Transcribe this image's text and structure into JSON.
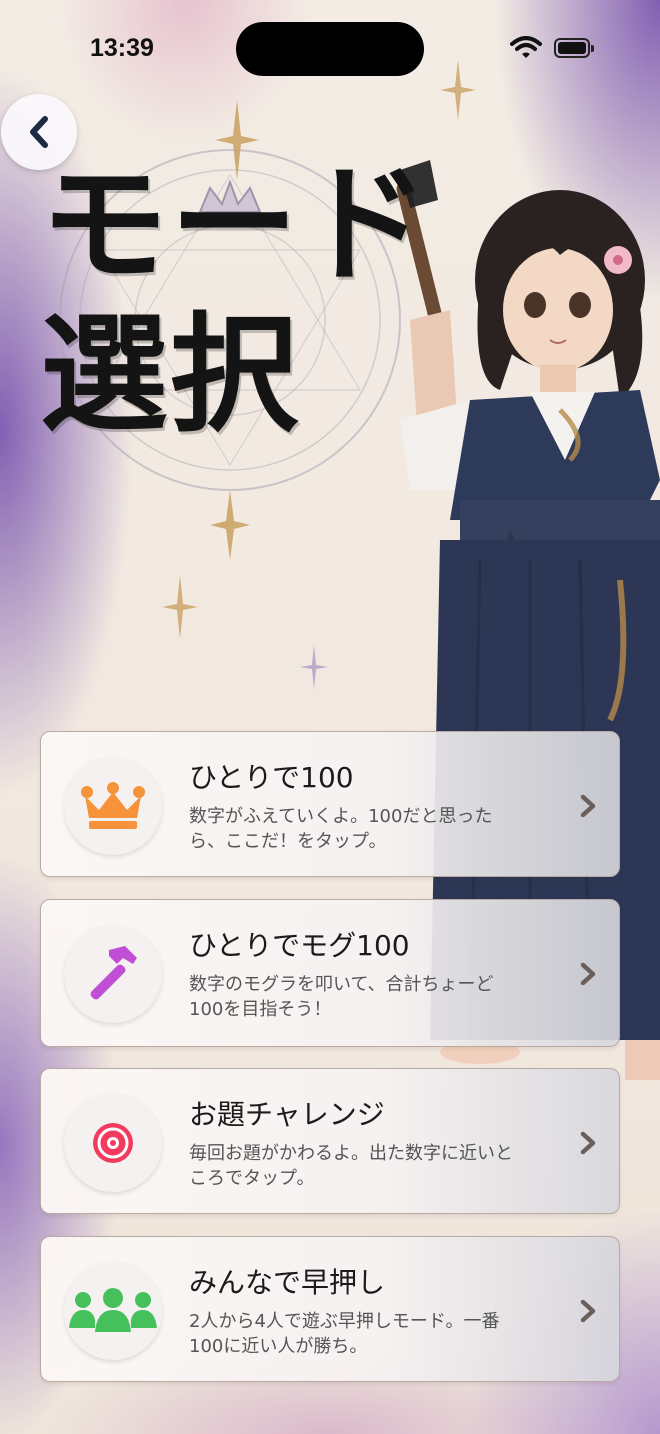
{
  "status_bar": {
    "time": "13:39"
  },
  "title": {
    "line1": "モード",
    "line2": "選択"
  },
  "modes": [
    {
      "title": "ひとりで100",
      "description": "数字がふえていくよ。100だと思ったら、ここだ！をタップ。",
      "icon": "crown-icon",
      "icon_color": "#f5923a"
    },
    {
      "title": "ひとりでモグ100",
      "description": "数字のモグラを叩いて、合計ちょーど100を目指そう！",
      "icon": "hammer-icon",
      "icon_color": "#c04fd6"
    },
    {
      "title": "お題チャレンジ",
      "description": "毎回お題がかわるよ。出た数字に近いところでタップ。",
      "icon": "target-icon",
      "icon_color": "#f23c5f"
    },
    {
      "title": "みんなで早押し",
      "description": "2人から4人で遊ぶ早押しモード。一番100に近い人が勝ち。",
      "icon": "group-icon",
      "icon_color": "#46c05a"
    }
  ]
}
